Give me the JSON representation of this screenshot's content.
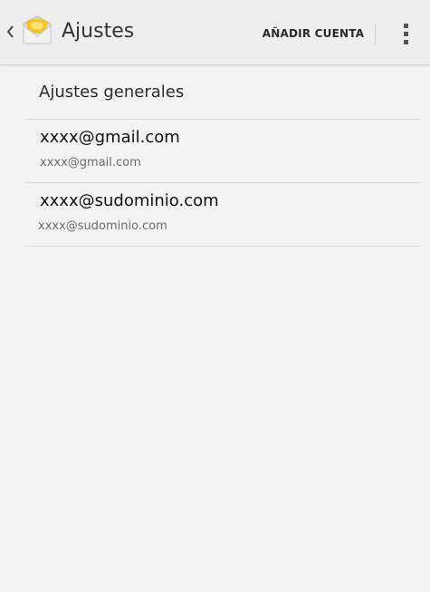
{
  "action_bar": {
    "title": "Ajustes",
    "add_account_label": "AÑADIR CUENTA",
    "up_icon": "chevron-left-icon",
    "app_icon": "email-app-icon",
    "overflow_icon": "more-vert-icon",
    "accent_color": "#f5c518"
  },
  "settings_list": {
    "general_label": "Ajustes generales",
    "accounts": [
      {
        "name": "xxxx@gmail.com",
        "email": "xxxx@gmail.com"
      },
      {
        "name": "xxxx@sudominio.com",
        "email": "xxxx@sudominio.com"
      }
    ]
  }
}
